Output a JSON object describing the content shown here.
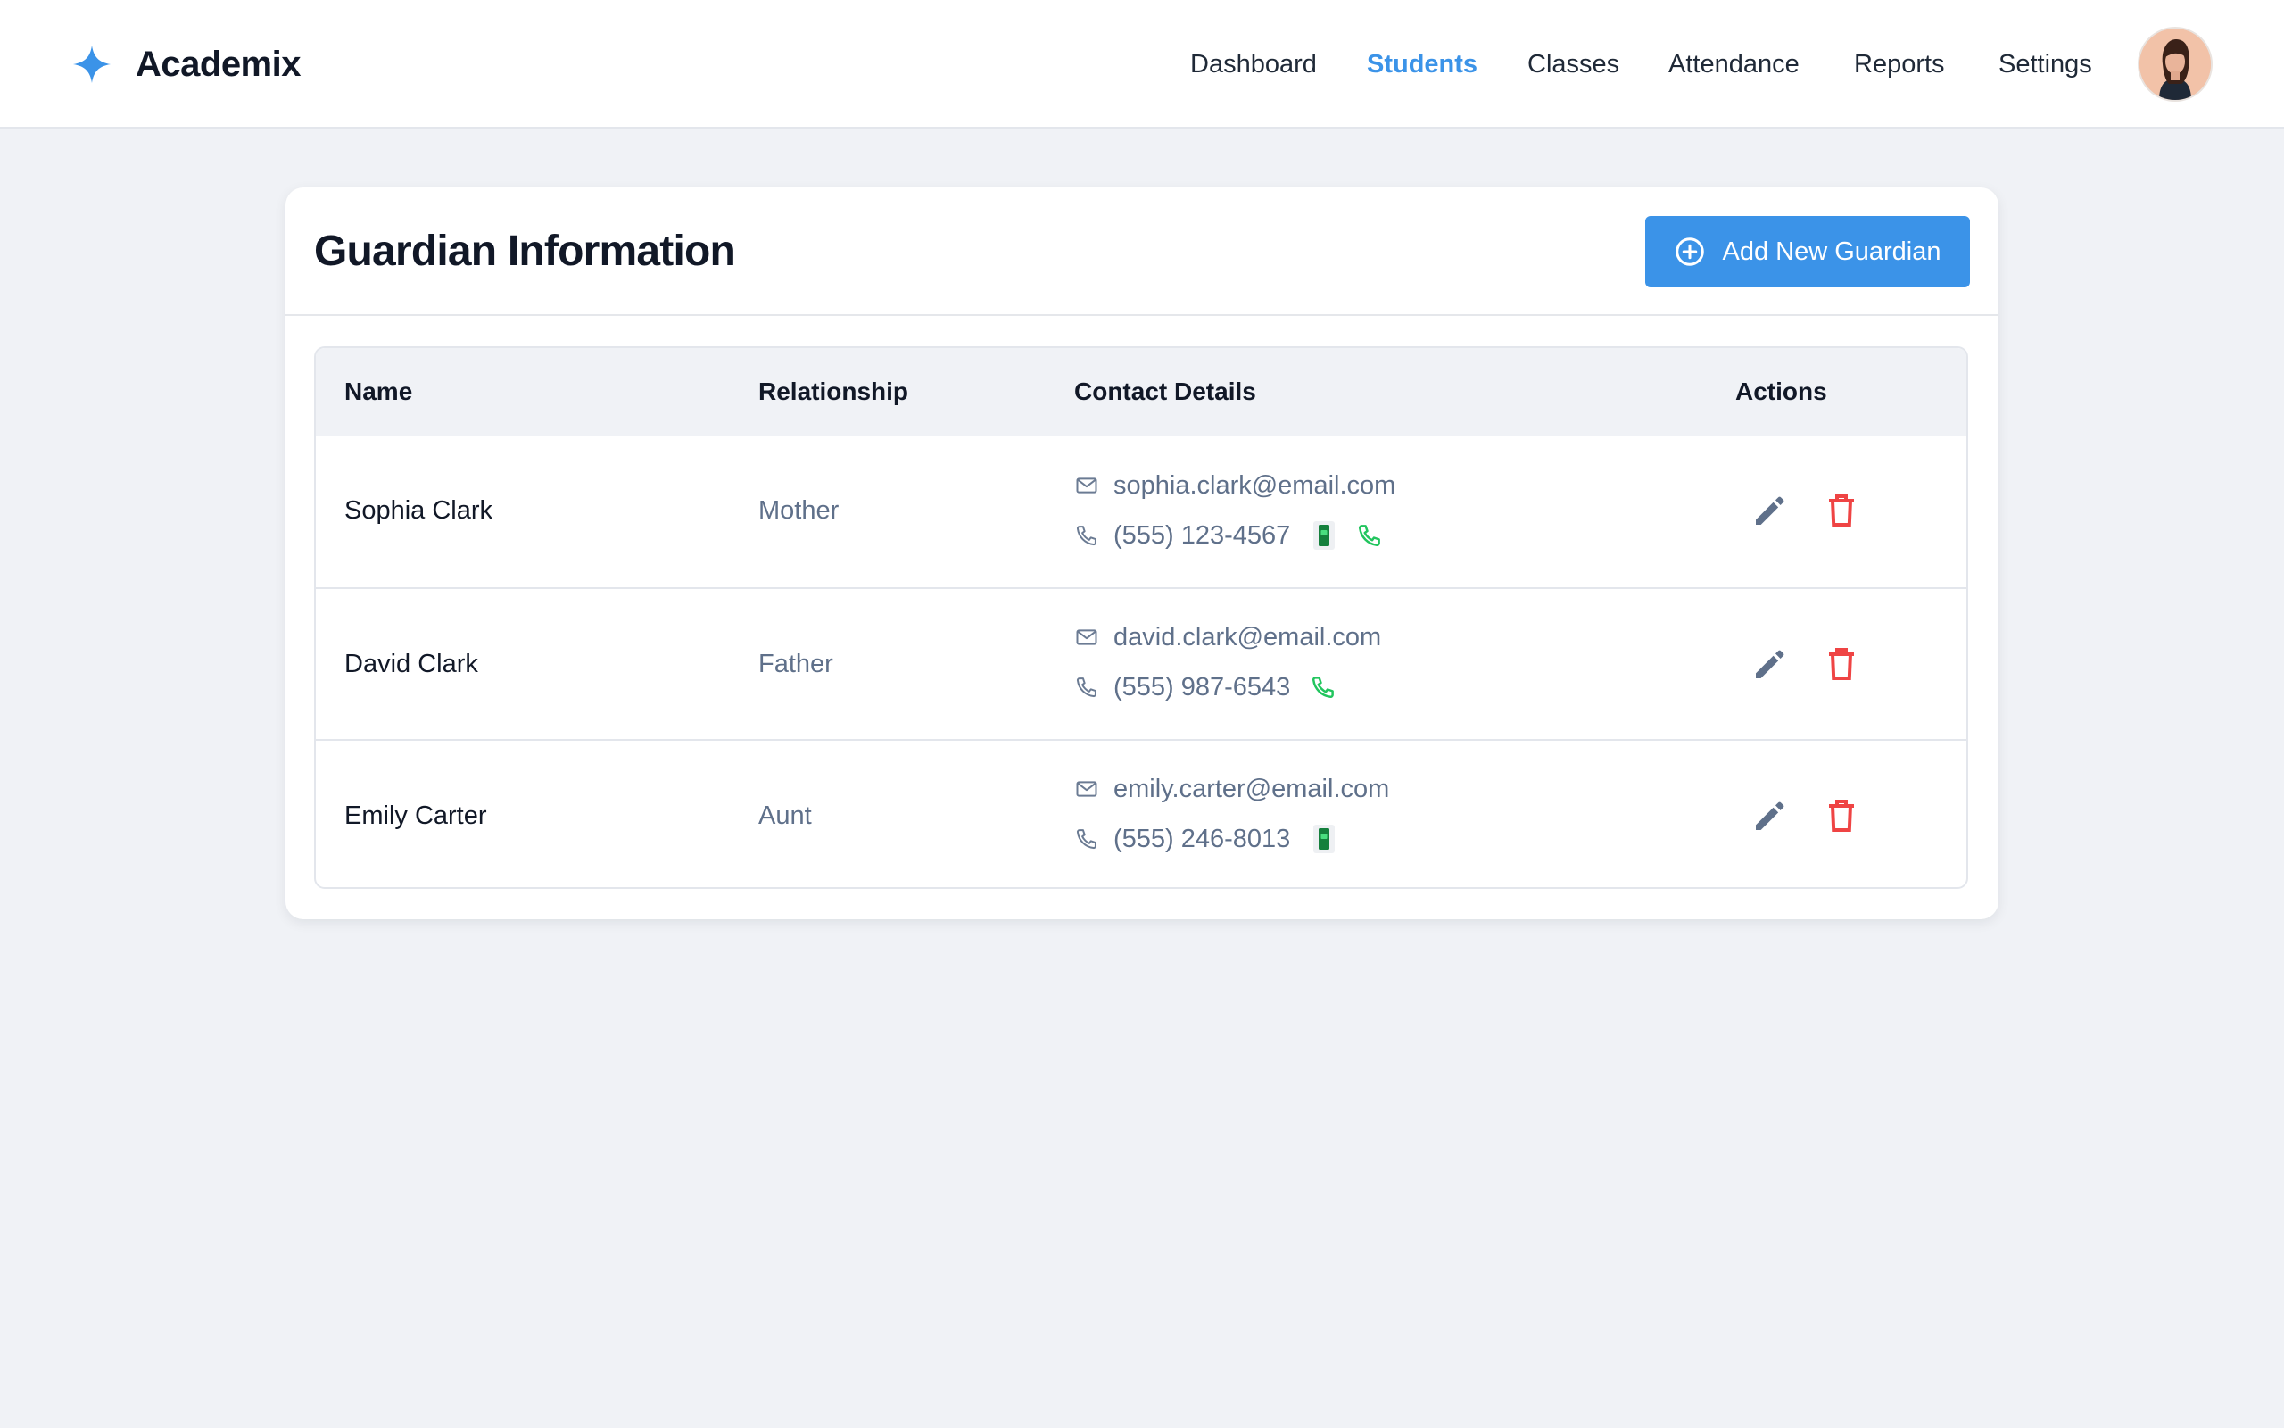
{
  "app": {
    "name": "Academix",
    "brand_color": "#3b93e8"
  },
  "nav": {
    "items": [
      {
        "label": "Dashboard",
        "active": false
      },
      {
        "label": "Students",
        "active": true
      },
      {
        "label": "Classes",
        "active": false
      },
      {
        "label": "Attendance",
        "active": false
      },
      {
        "label": "Reports",
        "active": false
      },
      {
        "label": "Settings",
        "active": false
      }
    ],
    "avatar_icon": "user-avatar"
  },
  "page": {
    "title": "Guardian Information",
    "add_button_label": "Add New Guardian",
    "add_button_icon": "plus-circle-icon"
  },
  "table": {
    "headers": {
      "name": "Name",
      "relationship": "Relationship",
      "contact": "Contact Details",
      "actions": "Actions"
    },
    "rows": [
      {
        "name": "Sophia Clark",
        "relationship": "Mother",
        "email": "sophia.clark@email.com",
        "phone": "(555) 123-4567",
        "badges": [
          "mobile-icon",
          "phone-call-icon"
        ]
      },
      {
        "name": "David Clark",
        "relationship": "Father",
        "email": "david.clark@email.com",
        "phone": "(555) 987-6543",
        "badges": [
          "phone-call-icon"
        ]
      },
      {
        "name": "Emily Carter",
        "relationship": "Aunt",
        "email": "emily.carter@email.com",
        "phone": "(555) 246-8013",
        "badges": [
          "mobile-icon"
        ]
      }
    ]
  },
  "colors": {
    "accent": "#3b93e8",
    "delete": "#ef4444",
    "edit": "#5f708a",
    "call_green": "#22c55e",
    "mobile_green": "#15803d"
  }
}
